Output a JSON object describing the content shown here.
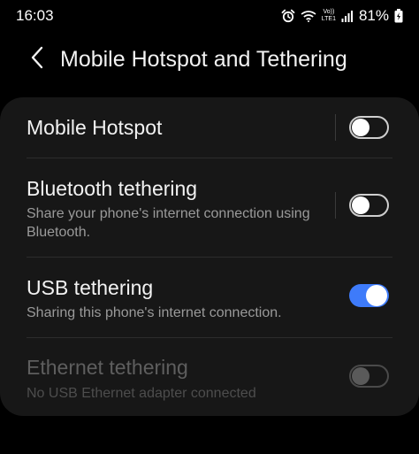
{
  "status_bar": {
    "time": "16:03",
    "alarm_icon": "alarm-icon",
    "wifi_icon": "wifi-icon",
    "volte_top": "Vo))",
    "volte_bottom": "LTE1",
    "signal_icon": "signal-icon",
    "battery_percent": "81%",
    "battery_icon": "battery-charging-icon"
  },
  "header": {
    "back_icon": "chevron-left-icon",
    "title": "Mobile Hotspot and Tethering"
  },
  "settings": [
    {
      "title": "Mobile Hotspot",
      "subtitle": "",
      "toggle_state": "off",
      "enabled": true
    },
    {
      "title": "Bluetooth tethering",
      "subtitle": "Share your phone's internet connection using Bluetooth.",
      "toggle_state": "off",
      "enabled": true
    },
    {
      "title": "USB tethering",
      "subtitle": "Sharing this phone's internet connection.",
      "toggle_state": "on",
      "enabled": true
    },
    {
      "title": "Ethernet tethering",
      "subtitle": "No USB Ethernet adapter connected",
      "toggle_state": "off",
      "enabled": false
    }
  ],
  "colors": {
    "background": "#000000",
    "card": "#171717",
    "accent": "#3e7bfa",
    "secondary_text": "#9a9a9a",
    "disabled_text": "#5e5e5e"
  }
}
